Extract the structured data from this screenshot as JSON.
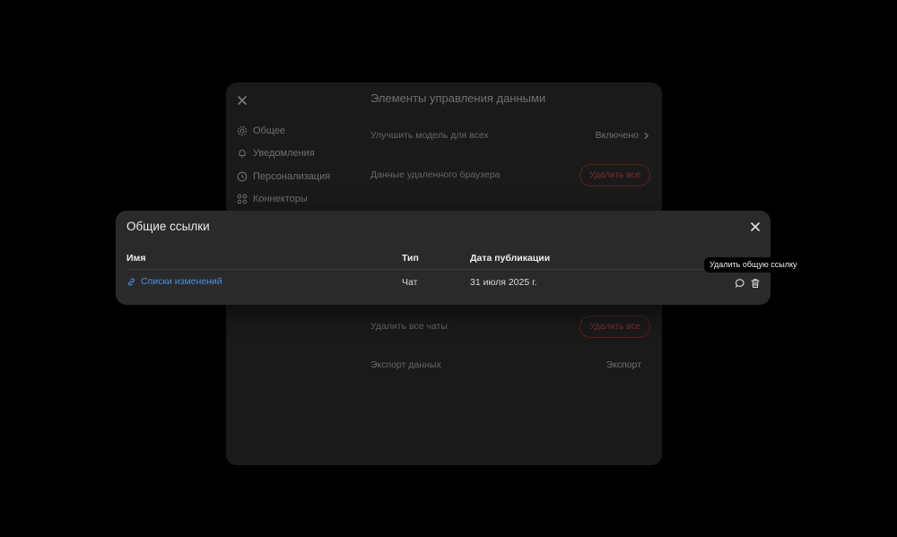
{
  "settings": {
    "title": "Элементы управления данными",
    "sidebar": [
      {
        "label": "Общее",
        "icon": "gear-icon"
      },
      {
        "label": "Уведомления",
        "icon": "bell-icon"
      },
      {
        "label": "Персонализация",
        "icon": "clock-icon"
      },
      {
        "label": "Коннекторы",
        "icon": "grid-icon"
      }
    ],
    "rows": [
      {
        "label": "Улучшить модель для всех",
        "value": "Включено"
      },
      {
        "label": "Данные удаленного браузера",
        "value": "Удалить все"
      },
      {
        "label": "Удалить все чаты",
        "value": "Удалить все"
      },
      {
        "label": "Экспорт данных",
        "value": "Экспорт"
      }
    ]
  },
  "modal": {
    "title": "Общие ссылки",
    "columns": {
      "name": "Имя",
      "type": "Тип",
      "date": "Дата публикации"
    },
    "rows": [
      {
        "name": "Списки изменений",
        "type": "Чат",
        "date": "31 июля 2025 г."
      }
    ]
  },
  "tooltip": {
    "text": "Удалить общую ссылку"
  }
}
